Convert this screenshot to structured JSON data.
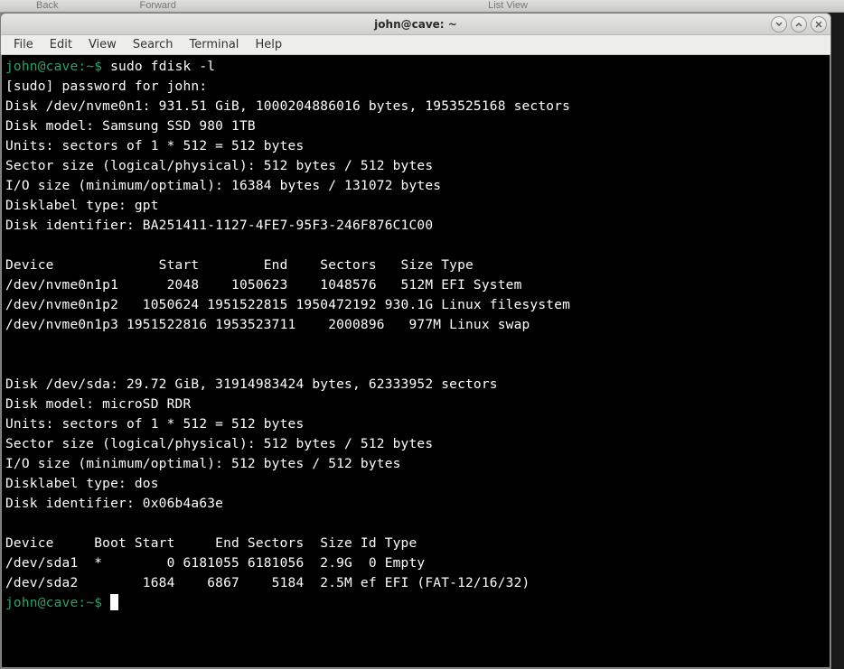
{
  "bgToolbar": {
    "back": "Back",
    "forward": "Forward",
    "listview": "List View"
  },
  "window": {
    "title": "john@cave: ~"
  },
  "menubar": {
    "items": [
      "File",
      "Edit",
      "View",
      "Search",
      "Terminal",
      "Help"
    ]
  },
  "prompt": {
    "userHost": "john@cave",
    "colon": ":",
    "path": "~",
    "dollar": "$ "
  },
  "terminal": {
    "cmd1": "sudo fdisk -l",
    "sudoLine": "[sudo] password for john:",
    "disk1": {
      "l1": "Disk /dev/nvme0n1: 931.51 GiB, 1000204886016 bytes, 1953525168 sectors",
      "l2": "Disk model: Samsung SSD 980 1TB                     ",
      "l3": "Units: sectors of 1 * 512 = 512 bytes",
      "l4": "Sector size (logical/physical): 512 bytes / 512 bytes",
      "l5": "I/O size (minimum/optimal): 16384 bytes / 131072 bytes",
      "l6": "Disklabel type: gpt",
      "l7": "Disk identifier: BA251411-1127-4FE7-95F3-246F876C1C00",
      "hdr": "Device             Start        End    Sectors   Size Type",
      "p1": "/dev/nvme0n1p1      2048    1050623    1048576   512M EFI System",
      "p2": "/dev/nvme0n1p2   1050624 1951522815 1950472192 930.1G Linux filesystem",
      "p3": "/dev/nvme0n1p3 1951522816 1953523711    2000896   977M Linux swap"
    },
    "disk2": {
      "l1": "Disk /dev/sda: 29.72 GiB, 31914983424 bytes, 62333952 sectors",
      "l2": "Disk model: microSD RDR     ",
      "l3": "Units: sectors of 1 * 512 = 512 bytes",
      "l4": "Sector size (logical/physical): 512 bytes / 512 bytes",
      "l5": "I/O size (minimum/optimal): 512 bytes / 512 bytes",
      "l6": "Disklabel type: dos",
      "l7": "Disk identifier: 0x06b4a63e",
      "hdr": "Device     Boot Start     End Sectors  Size Id Type",
      "p1": "/dev/sda1  *        0 6181055 6181056  2.9G  0 Empty",
      "p2": "/dev/sda2        1684    6867    5184  2.5M ef EFI (FAT-12/16/32)"
    }
  }
}
